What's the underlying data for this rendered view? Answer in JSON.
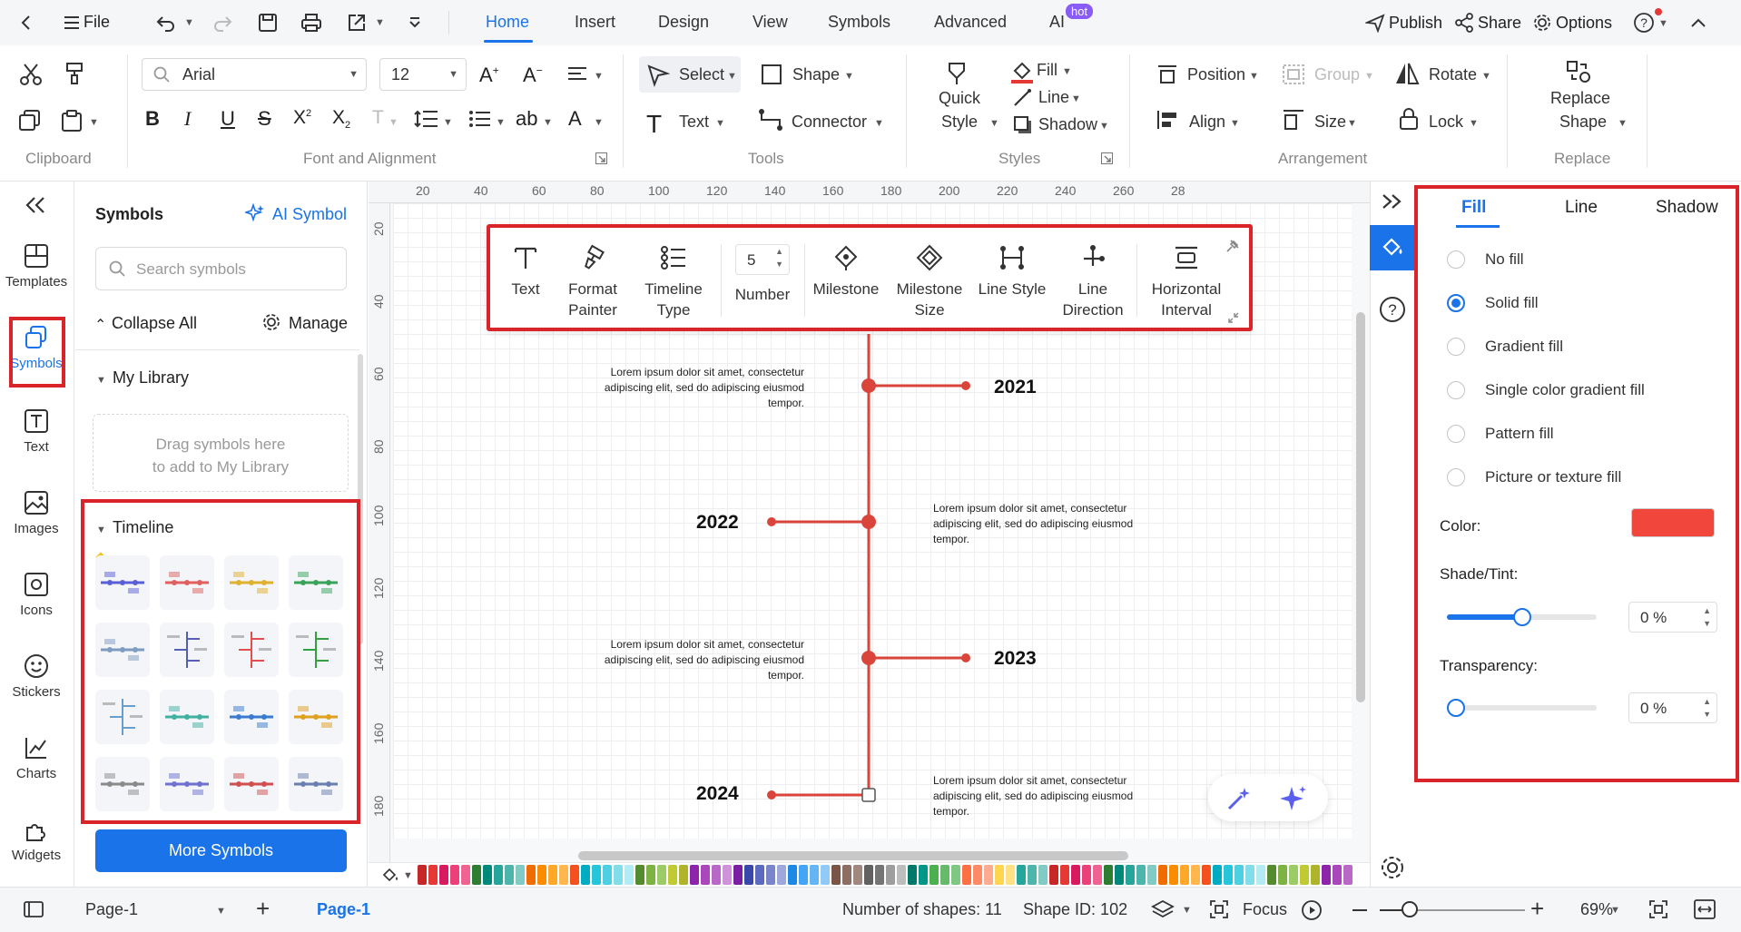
{
  "topbar": {
    "file_label": "File",
    "tabs": [
      "Home",
      "Insert",
      "Design",
      "View",
      "Symbols",
      "Advanced",
      "AI"
    ],
    "ai_badge": "hot",
    "publish": "Publish",
    "share": "Share",
    "options": "Options"
  },
  "ribbon": {
    "font_name": "Arial",
    "font_size": "12",
    "select": "Select",
    "shape": "Shape",
    "text": "Text",
    "connector": "Connector",
    "quick_style_1": "Quick",
    "quick_style_2": "Style",
    "fill": "Fill",
    "line": "Line",
    "shadow": "Shadow",
    "position": "Position",
    "group": "Group",
    "rotate": "Rotate",
    "align": "Align",
    "size": "Size",
    "lock": "Lock",
    "replace_1": "Replace",
    "replace_2": "Shape",
    "groups": {
      "clipboard": "Clipboard",
      "font": "Font and Alignment",
      "tools": "Tools",
      "styles": "Styles",
      "arrangement": "Arrangement",
      "replace": "Replace"
    }
  },
  "leftbar": {
    "items": [
      "Templates",
      "Symbols",
      "Text",
      "Images",
      "Icons",
      "Stickers",
      "Charts",
      "Widgets"
    ]
  },
  "symbols_panel": {
    "title": "Symbols",
    "ai_symbol": "AI Symbol",
    "search_placeholder": "Search symbols",
    "collapse_all": "Collapse All",
    "manage": "Manage",
    "my_library": "My Library",
    "drop_hint_1": "Drag symbols here",
    "drop_hint_2": "to add to My Library",
    "timeline": "Timeline",
    "more_symbols": "More Symbols"
  },
  "ruler": {
    "top": [
      "20",
      "40",
      "60",
      "80",
      "100",
      "120",
      "140",
      "160",
      "180",
      "200",
      "220",
      "240",
      "260",
      "28"
    ],
    "left": [
      "20",
      "40",
      "60",
      "80",
      "100",
      "120",
      "140",
      "160",
      "180"
    ]
  },
  "float_toolbar": {
    "text": "Text",
    "format_painter_1": "Format",
    "format_painter_2": "Painter",
    "timeline_type_1": "Timeline",
    "timeline_type_2": "Type",
    "number_value": "5",
    "number": "Number",
    "milestone": "Milestone",
    "milestone_size_1": "Milestone",
    "milestone_size_2": "Size",
    "line_style": "Line Style",
    "line_direction_1": "Line",
    "line_direction_2": "Direction",
    "horizontal_interval_1": "Horizontal",
    "horizontal_interval_2": "Interval"
  },
  "timeline": {
    "accent": "#d9453a",
    "lorem_1": "Lorem ipsum dolor sit amet, consectetur",
    "lorem_2": "adipiscing elit, sed do adipiscing eiusmod",
    "lorem_3": "tempor.",
    "years": [
      "2021",
      "2022",
      "2023",
      "2024"
    ]
  },
  "right_panel": {
    "tabs": [
      "Fill",
      "Line",
      "Shadow"
    ],
    "options": [
      "No fill",
      "Solid fill",
      "Gradient fill",
      "Single color gradient fill",
      "Pattern fill",
      "Picture or texture fill"
    ],
    "selected": "Solid fill",
    "color_label": "Color:",
    "color": "#f0463c",
    "shade_label": "Shade/Tint:",
    "shade_value": "0 %",
    "shade_level": 0.5,
    "transparency_label": "Transparency:",
    "transparency_value": "0 %",
    "transparency_level": 0
  },
  "statusbar": {
    "page_select": "Page-1",
    "page_tab": "Page-1",
    "shapes": "Number of shapes: 11",
    "shape_id": "Shape ID: 102",
    "focus": "Focus",
    "zoom": "69%"
  }
}
